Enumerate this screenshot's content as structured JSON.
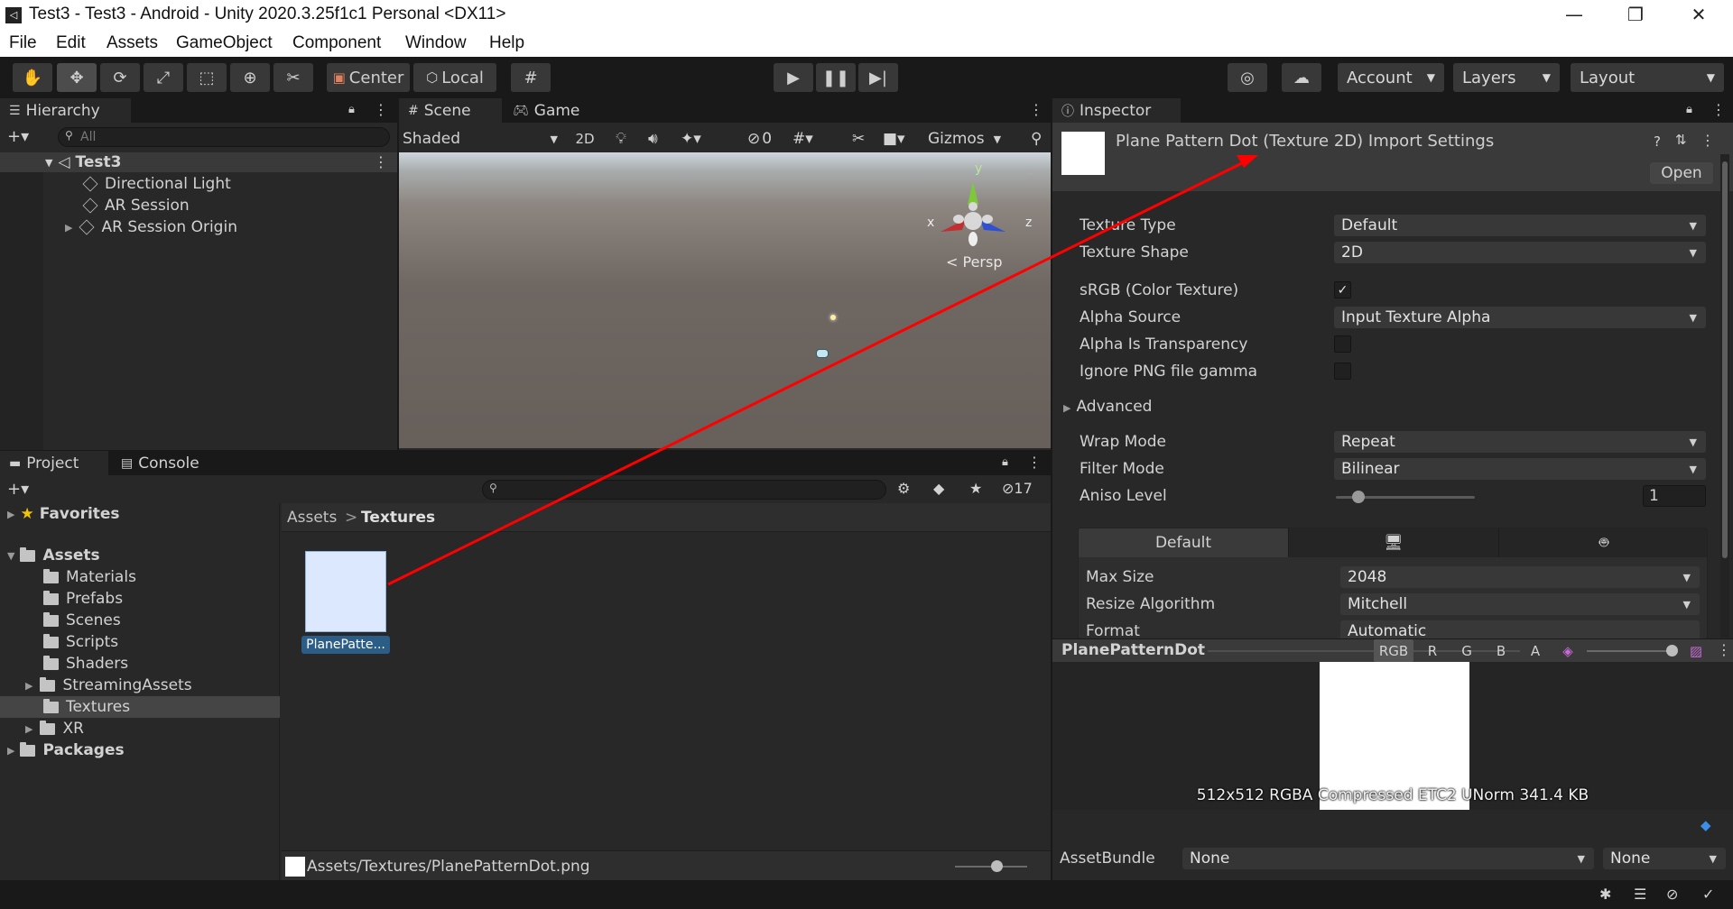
{
  "window": {
    "title": "Test3 - Test3 - Android - Unity 2020.3.25f1c1 Personal <DX11>",
    "minimize": "—",
    "maximize": "❐",
    "close": "✕"
  },
  "menu": [
    "File",
    "Edit",
    "Assets",
    "GameObject",
    "Component",
    "Window",
    "Help"
  ],
  "toolbar": {
    "pivot": "Center",
    "space": "Local",
    "account": "Account",
    "layers": "Layers",
    "layout": "Layout"
  },
  "hierarchy": {
    "tab": "Hierarchy",
    "search_placeholder": "All",
    "scene": "Test3",
    "items": [
      "Directional Light",
      "AR Session",
      "AR Session Origin"
    ]
  },
  "scene": {
    "tab_scene": "Scene",
    "tab_game": "Game",
    "shading": "Shaded",
    "mode_2d": "2D",
    "hidden_count": "0",
    "gizmos": "Gizmos",
    "persp": "Persp",
    "axis_x": "x",
    "axis_y": "y",
    "axis_z": "z"
  },
  "inspector": {
    "tab": "Inspector",
    "asset_title": "Plane Pattern Dot (Texture 2D) Import Settings",
    "open": "Open",
    "texture_type_label": "Texture Type",
    "texture_type": "Default",
    "texture_shape_label": "Texture Shape",
    "texture_shape": "2D",
    "srgb_label": "sRGB (Color Texture)",
    "srgb_checked": true,
    "alpha_source_label": "Alpha Source",
    "alpha_source": "Input Texture Alpha",
    "alpha_transparency_label": "Alpha Is Transparency",
    "ignore_png_label": "Ignore PNG file gamma",
    "advanced_label": "Advanced",
    "wrap_mode_label": "Wrap Mode",
    "wrap_mode": "Repeat",
    "filter_mode_label": "Filter Mode",
    "filter_mode": "Bilinear",
    "aniso_label": "Aniso Level",
    "aniso_value": "1",
    "platform_default": "Default",
    "max_size_label": "Max Size",
    "max_size": "2048",
    "resize_label": "Resize Algorithm",
    "resize": "Mitchell",
    "format_label": "Format",
    "format": "Automatic"
  },
  "preview": {
    "name": "PlanePatternDot",
    "channels": [
      "RGB",
      "R",
      "G",
      "B",
      "A"
    ],
    "info": "512x512  RGBA Compressed ETC2 UNorm   341.4 KB",
    "assetbundle_label": "AssetBundle",
    "assetbundle": "None",
    "variant": "None"
  },
  "project": {
    "tab_project": "Project",
    "tab_console": "Console",
    "hidden_count": "17",
    "favorites": "Favorites",
    "assets": "Assets",
    "folders": [
      "Materials",
      "Prefabs",
      "Scenes",
      "Scripts",
      "Shaders",
      "StreamingAssets",
      "Textures",
      "XR"
    ],
    "packages": "Packages",
    "breadcrumb_root": "Assets",
    "breadcrumb_current": "Textures",
    "asset_label": "PlanePatte...",
    "asset_path": "Assets/Textures/PlanePatternDot.png"
  },
  "colors": {
    "accent_selection": "#2c5d87",
    "annotation_arrow": "#ff0000"
  }
}
